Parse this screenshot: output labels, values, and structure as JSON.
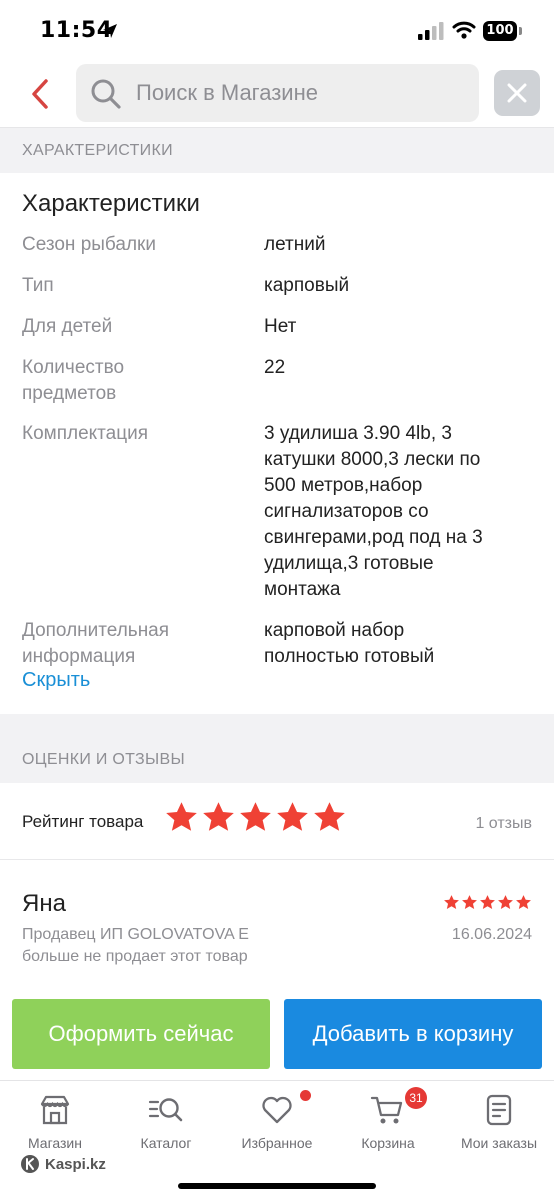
{
  "status_bar": {
    "time": "11:54",
    "battery": "100"
  },
  "search": {
    "placeholder": "Поиск в Магазине"
  },
  "sections": {
    "specs_header": "ХАРАКТЕРИСТИКИ",
    "reviews_header": "ОЦЕНКИ И ОТЗЫВЫ"
  },
  "specs": {
    "title": "Характеристики",
    "rows": [
      {
        "label": "Сезон рыбалки",
        "value": "летний"
      },
      {
        "label": "Тип",
        "value": "карповый"
      },
      {
        "label": "Для детей",
        "value": "Нет"
      },
      {
        "label": "Количество\nпредметов",
        "value": "22"
      },
      {
        "label": "Комплектация",
        "value": "3 удилиша 3.90 4lb, 3\nкатушки 8000,3 лески по\n500 метров,набор\nсигнализаторов со\nсвингерами,род под на 3\nудилища,3 готовые\nмонтажа"
      },
      {
        "label": "Дополнительная\nинформация",
        "value": "карповой набор\nполностью готовый"
      }
    ],
    "hide_link": "Скрыть"
  },
  "rating": {
    "label": "Рейтинг товара",
    "stars": 5,
    "max_stars": 5,
    "count": "1 отзыв"
  },
  "review": {
    "author": "Яна",
    "stars": 5,
    "date": "16.06.2024",
    "seller_note": "Продавец ИП GOLOVATOVA E\nбольше не продает этот товар"
  },
  "actions": {
    "buy_now": "Оформить сейчас",
    "add_to_cart": "Добавить в корзину"
  },
  "nav": {
    "items": [
      {
        "label": "Магазин",
        "icon": "shop-icon"
      },
      {
        "label": "Каталог",
        "icon": "catalog-search-icon"
      },
      {
        "label": "Избранное",
        "icon": "heart-icon"
      },
      {
        "label": "Корзина",
        "icon": "cart-icon"
      },
      {
        "label": "Мои заказы",
        "icon": "orders-icon"
      }
    ],
    "cart_badge": "31"
  },
  "brand": "Kaspi.kz",
  "colors": {
    "accent_red": "#e53935",
    "star_red": "#ef4135",
    "link_blue": "#1a8fd6",
    "buy_green": "#8fd15a",
    "cart_blue": "#1a8ae0"
  }
}
